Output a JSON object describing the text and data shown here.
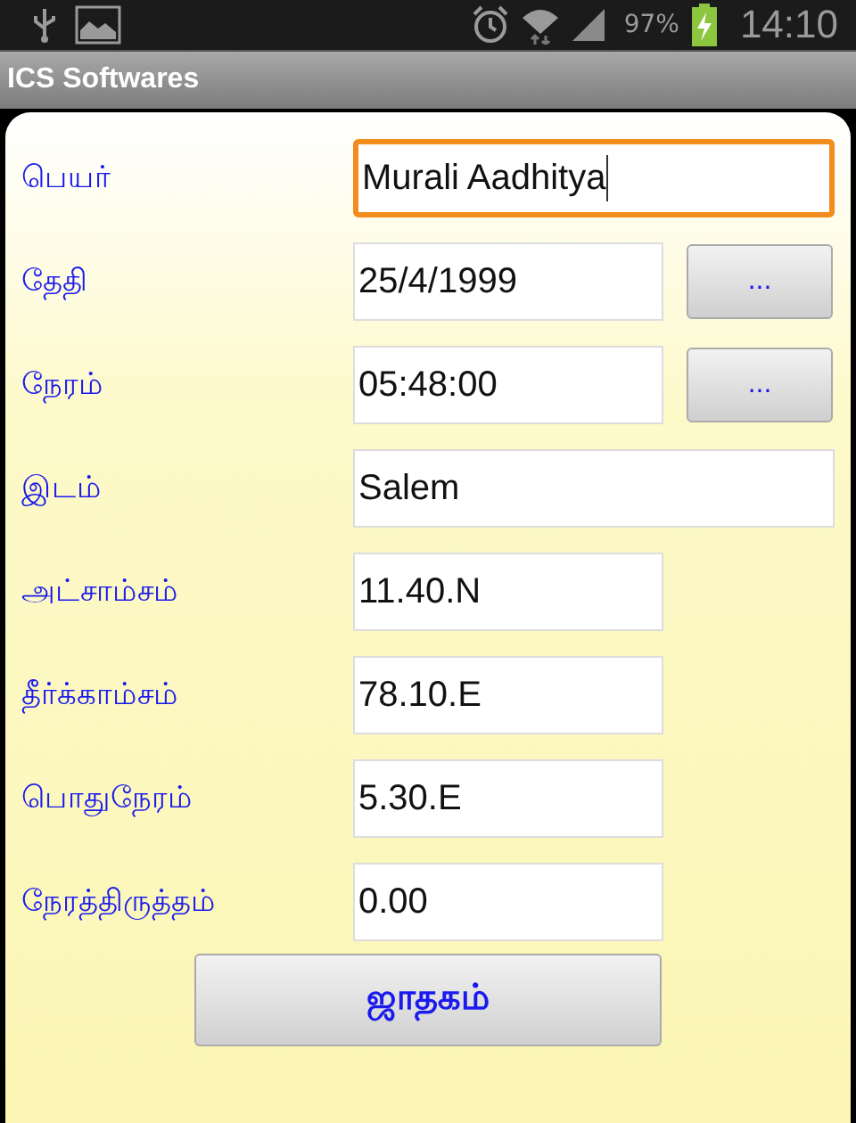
{
  "status_bar": {
    "battery_text": "97%",
    "time": "14:10"
  },
  "app_bar": {
    "title": "ICS Softwares"
  },
  "form": {
    "rows": [
      {
        "kind": "wide",
        "label": "பெயர்",
        "value": "Murali Aadhitya",
        "focused": true
      },
      {
        "kind": "picker",
        "label": "தேதி",
        "value": "25/4/1999",
        "button": "..."
      },
      {
        "kind": "picker",
        "label": "நேரம்",
        "value": "05:48:00",
        "button": "..."
      },
      {
        "kind": "wide",
        "label": "இடம்",
        "value": "Salem",
        "focused": false
      },
      {
        "kind": "short",
        "label": "அட்சாம்சம்",
        "value": "11.40.N"
      },
      {
        "kind": "short",
        "label": "தீர்க்காம்சம்",
        "value": "78.10.E"
      },
      {
        "kind": "short",
        "label": "பொதுநேரம்",
        "value": "5.30.E"
      },
      {
        "kind": "short",
        "label": "நேரத்திருத்தம்",
        "value": "0.00"
      }
    ],
    "submit": "ஜாதகம்"
  }
}
